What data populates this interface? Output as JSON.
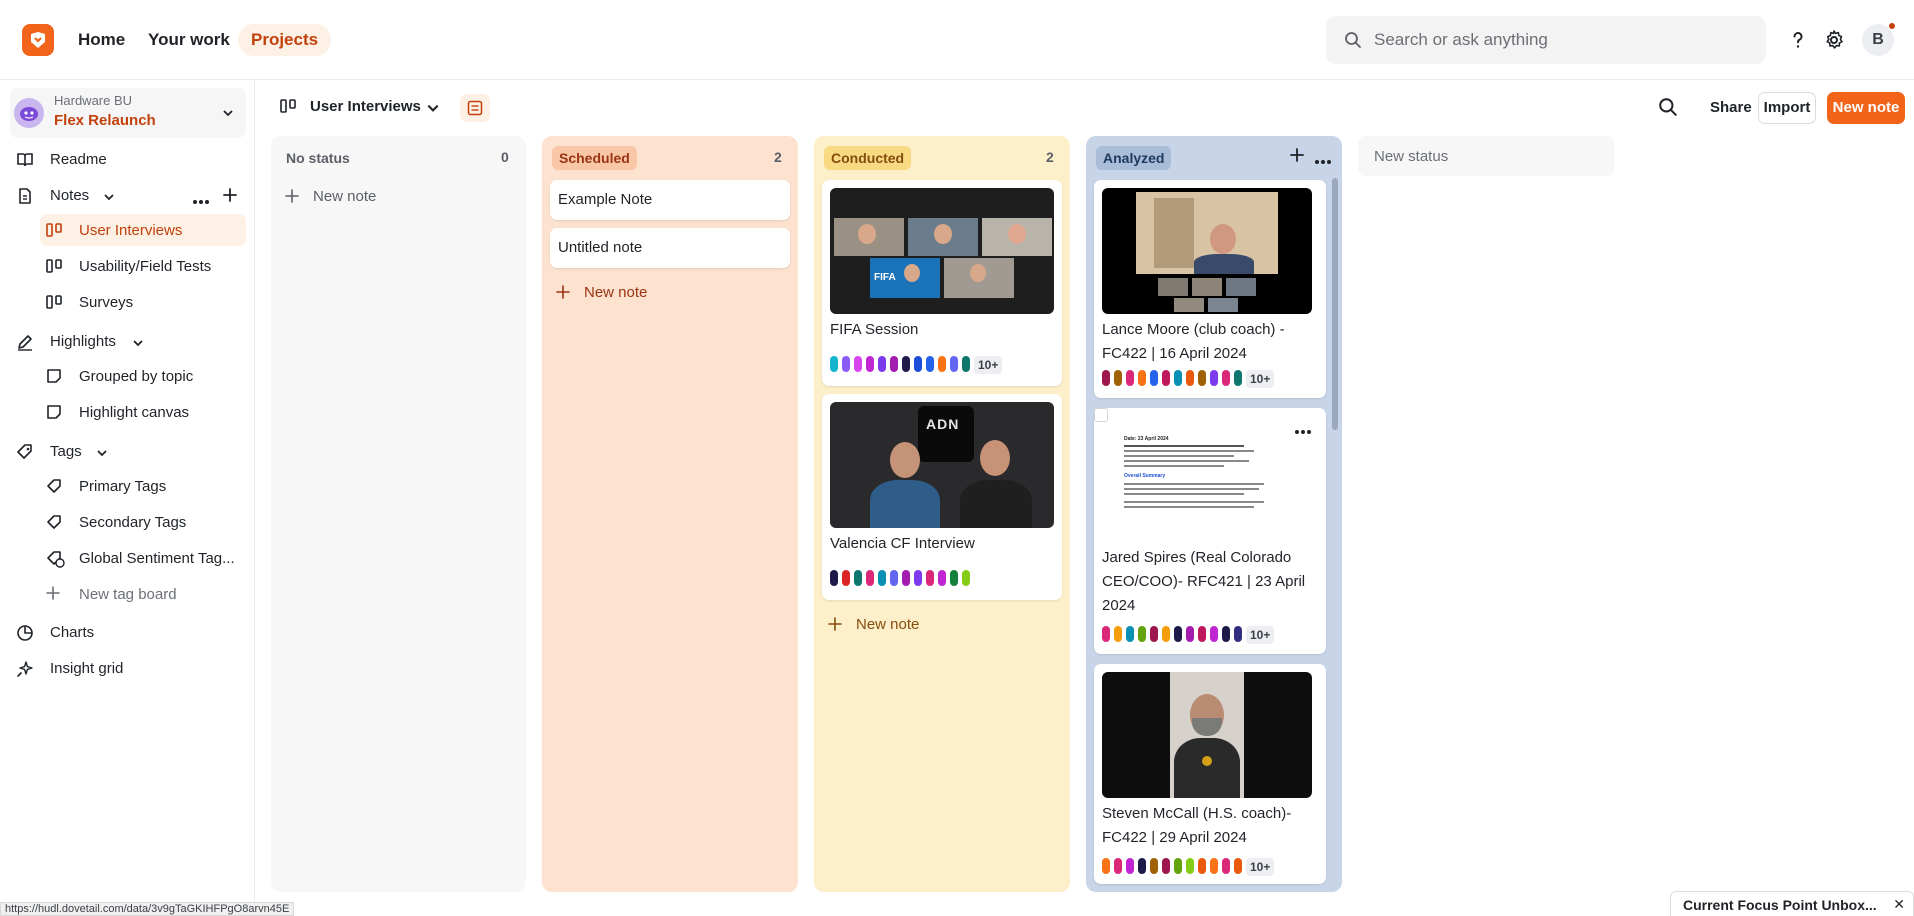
{
  "topbar": {
    "nav": [
      "Home",
      "Your work",
      "Projects"
    ],
    "search_placeholder": "Search or ask anything",
    "avatar_letter": "B"
  },
  "sidebar": {
    "workspace_org": "Hardware BU",
    "workspace_name": "Flex Relaunch",
    "readme": "Readme",
    "notes": "Notes",
    "notes_items": [
      "User Interviews",
      "Usability/Field Tests",
      "Surveys"
    ],
    "highlights": "Highlights",
    "highlights_items": [
      "Grouped by topic",
      "Highlight canvas"
    ],
    "tags": "Tags",
    "tags_items": [
      "Primary Tags",
      "Secondary Tags",
      "Global Sentiment Tag..."
    ],
    "new_tag_board": "New tag board",
    "charts": "Charts",
    "insight_grid": "Insight grid"
  },
  "toolbar": {
    "view_title": "User Interviews",
    "share": "Share",
    "import": "Import",
    "new_note": "New note"
  },
  "board": {
    "new_note_label": "New note",
    "new_status": "New status",
    "columns": [
      {
        "name": "No status",
        "count": "0",
        "cards": []
      },
      {
        "name": "Scheduled",
        "count": "2",
        "cards": [
          "Example Note",
          "Untitled note"
        ]
      },
      {
        "name": "Conducted",
        "count": "2",
        "cards": [
          "FIFA Session",
          "Valencia CF Interview"
        ]
      },
      {
        "name": "Analyzed",
        "count": "",
        "cards": [
          "Lance Moore (club coach) - FC422 | 16 April 2024",
          "Jared Spires (Real Colorado CEO/COO)- RFC421 | 23 April 2024",
          "Steven McCall (H.S. coach)- FC422 | 29 April 2024"
        ]
      }
    ],
    "more_tags": "10+",
    "thumb_text": {
      "fifa": "FIFA",
      "adn": "ADN",
      "doc_date": "Date: 23 April 2024",
      "doc_heading": "Overall Summary"
    }
  },
  "statusbar": {
    "url": "https://hudl.dovetail.com/data/3v9gTaGKIHFPgO8arvn45E",
    "popup": "Current Focus Point Unbox..."
  },
  "colors": {
    "accent": "#f26419",
    "accent_text": "#c2410c",
    "scheduled_bg": "#fde2d0",
    "conducted_bg": "#fdefc9",
    "analyzed_bg": "#c8d5e8"
  },
  "icons": [
    "logo-icon",
    "search-icon",
    "help-icon",
    "gear-icon",
    "board-icon",
    "document-icon",
    "pen-icon",
    "tag-icon",
    "chart-icon",
    "sparkle-icon",
    "plus-icon",
    "more-icon",
    "chevron-down-icon",
    "close-icon"
  ]
}
